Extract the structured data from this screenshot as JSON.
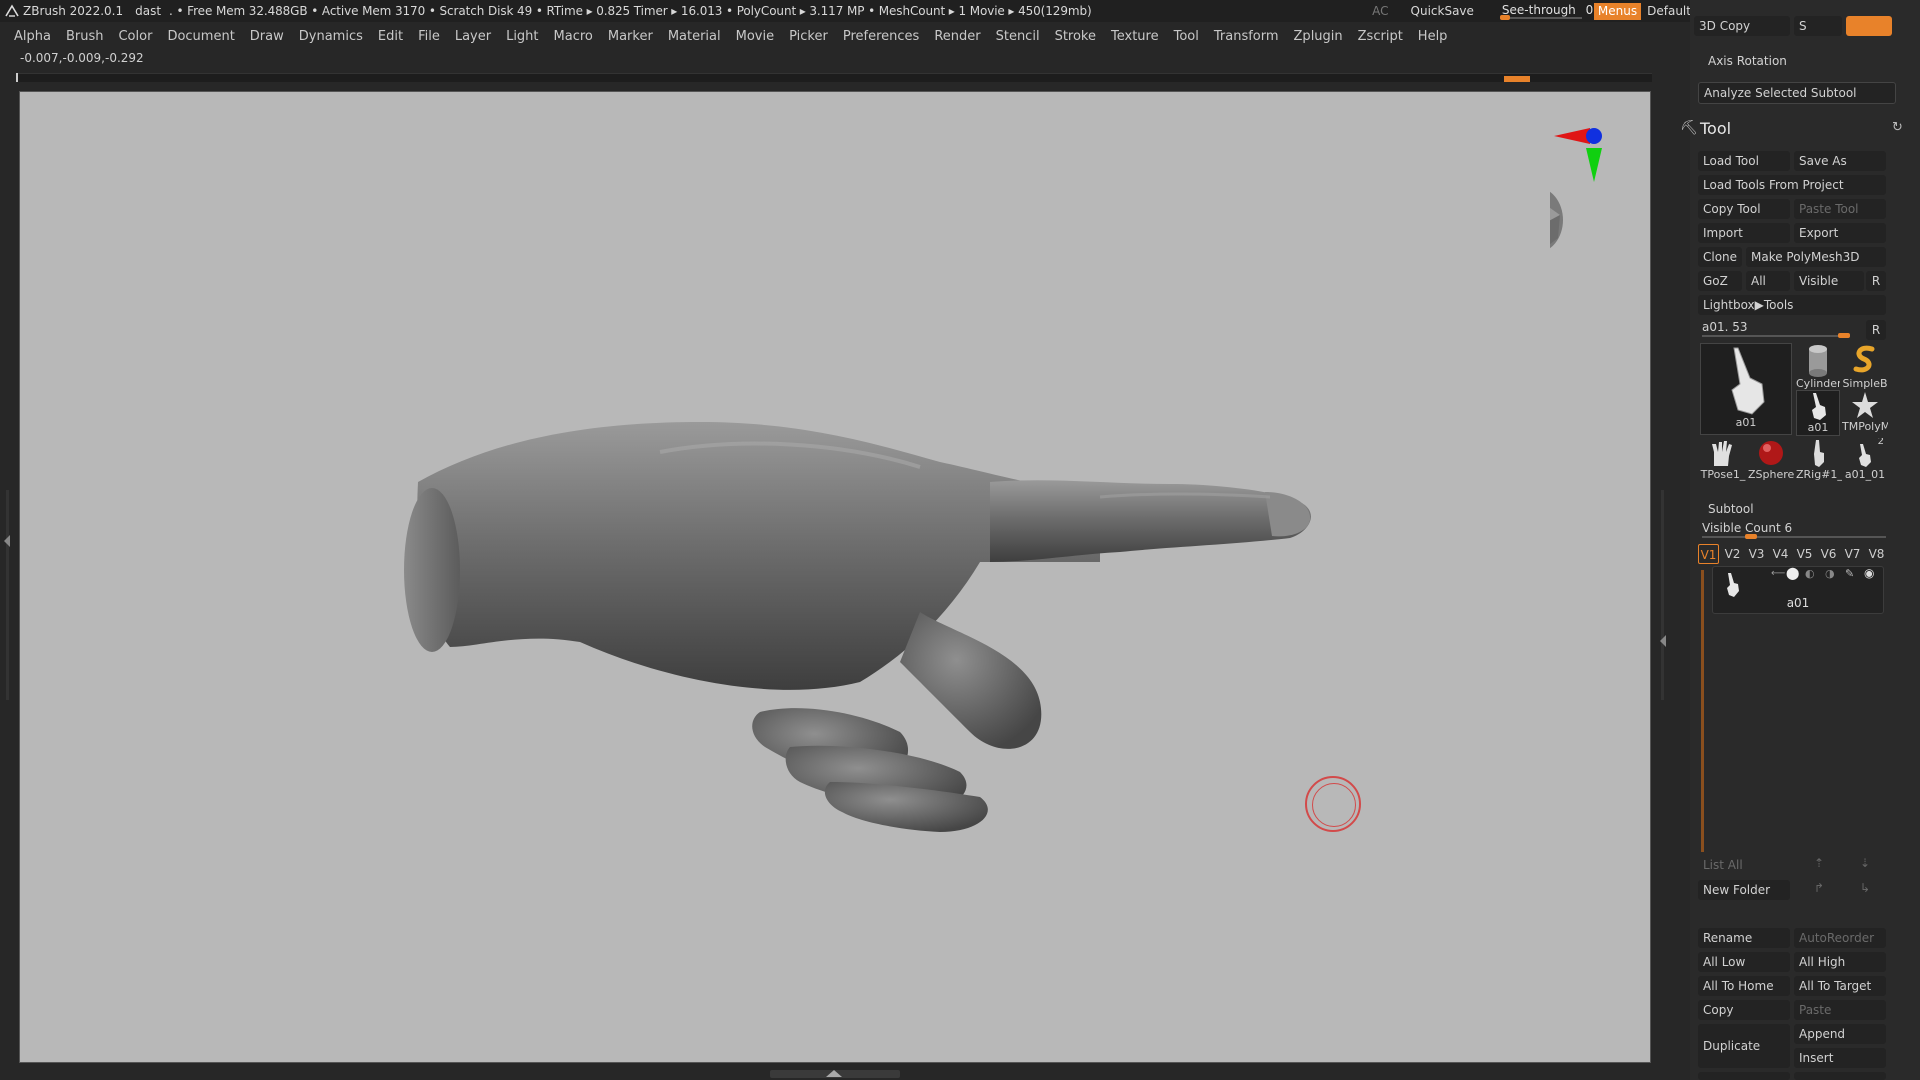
{
  "titlebar": {
    "app": "ZBrush 2022.0.1",
    "document": "dast",
    "stats": ". • Free Mem 32.488GB • Active Mem 3170 • Scratch Disk 49 • RTime ▸ 0.825 Timer ▸ 16.013 • PolyCount ▸ 3.117 MP  • MeshCount ▸ 1  Movie ▸ 450(129mb)",
    "ac": "AC",
    "quicksave": "QuickSave",
    "seethrough_label": "See-through",
    "seethrough_value": "0",
    "seethrough_level": 0,
    "menus": "Menus",
    "script": "DefaultZScript"
  },
  "menubar": [
    "Alpha",
    "Brush",
    "Color",
    "Document",
    "Draw",
    "Dynamics",
    "Edit",
    "File",
    "Layer",
    "Light",
    "Macro",
    "Marker",
    "Material",
    "Movie",
    "Picker",
    "Preferences",
    "Render",
    "Stencil",
    "Stroke",
    "Texture",
    "Tool",
    "Transform",
    "Zplugin",
    "Zscript",
    "Help"
  ],
  "coords": "-0.007,-0.009,-0.292",
  "colors": {
    "accent": "#e8822a",
    "viewport": "#b8b8b8",
    "panel": "#2a2a2a"
  },
  "icons": {
    "gizmo": "axis-gizmo-icon",
    "head": "head-navigator-icon",
    "brush_cursor": "brush-cursor-icon"
  },
  "palette": {
    "top_partial": {
      "copy3d": "3D Copy",
      "s": "S"
    },
    "axis_rotation": "Axis Rotation",
    "analyze": "Analyze Selected Subtool",
    "tool_title": "Tool",
    "buttons": {
      "load_tool": "Load Tool",
      "save_as": "Save As",
      "load_from_project": "Load Tools From Project",
      "copy_tool": "Copy Tool",
      "paste_tool": "Paste Tool",
      "import": "Import",
      "export": "Export",
      "clone": "Clone",
      "make_polymesh": "Make PolyMesh3D",
      "goz": "GoZ",
      "all": "All",
      "visible": "Visible",
      "r": "R",
      "lightbox_tools": "Lightbox▶Tools"
    },
    "current_tool": "a01. 53",
    "current_tool_r": "R",
    "thumbs": [
      {
        "label": "a01",
        "icon": "pointing-hand-icon"
      },
      {
        "label": "Cylinder",
        "icon": "cylinder-icon"
      },
      {
        "label": "SimpleB",
        "icon": "simple-brush-icon"
      },
      {
        "label": "a01",
        "icon": "pointing-hand-icon"
      },
      {
        "label": "TMPolyM",
        "icon": "star-icon"
      },
      {
        "label": "TPose1_",
        "icon": "hand-icon"
      },
      {
        "label": "ZSphere",
        "icon": "zsphere-icon"
      },
      {
        "label": "ZRig#1_",
        "icon": "rig-hand-icon"
      },
      {
        "label": "a01_01",
        "icon": "pointing-hand-icon"
      }
    ],
    "thumb_badge": "2",
    "subtool": {
      "title": "Subtool",
      "visible_count": "Visible Count 6",
      "visible_count_level": 0.25,
      "tabs": [
        "V1",
        "V2",
        "V3",
        "V4",
        "V5",
        "V6",
        "V7",
        "V8"
      ],
      "active_tab": "V1",
      "row_name": "a01"
    },
    "lower_buttons": {
      "list_all": "List All",
      "new_folder": "New Folder",
      "rename": "Rename",
      "autoreorder": "AutoReorder",
      "all_low": "All Low",
      "all_high": "All High",
      "all_to_home": "All To Home",
      "all_to_target": "All To Target",
      "copy": "Copy",
      "paste": "Paste",
      "duplicate": "Duplicate",
      "append": "Append",
      "insert": "Insert"
    }
  }
}
